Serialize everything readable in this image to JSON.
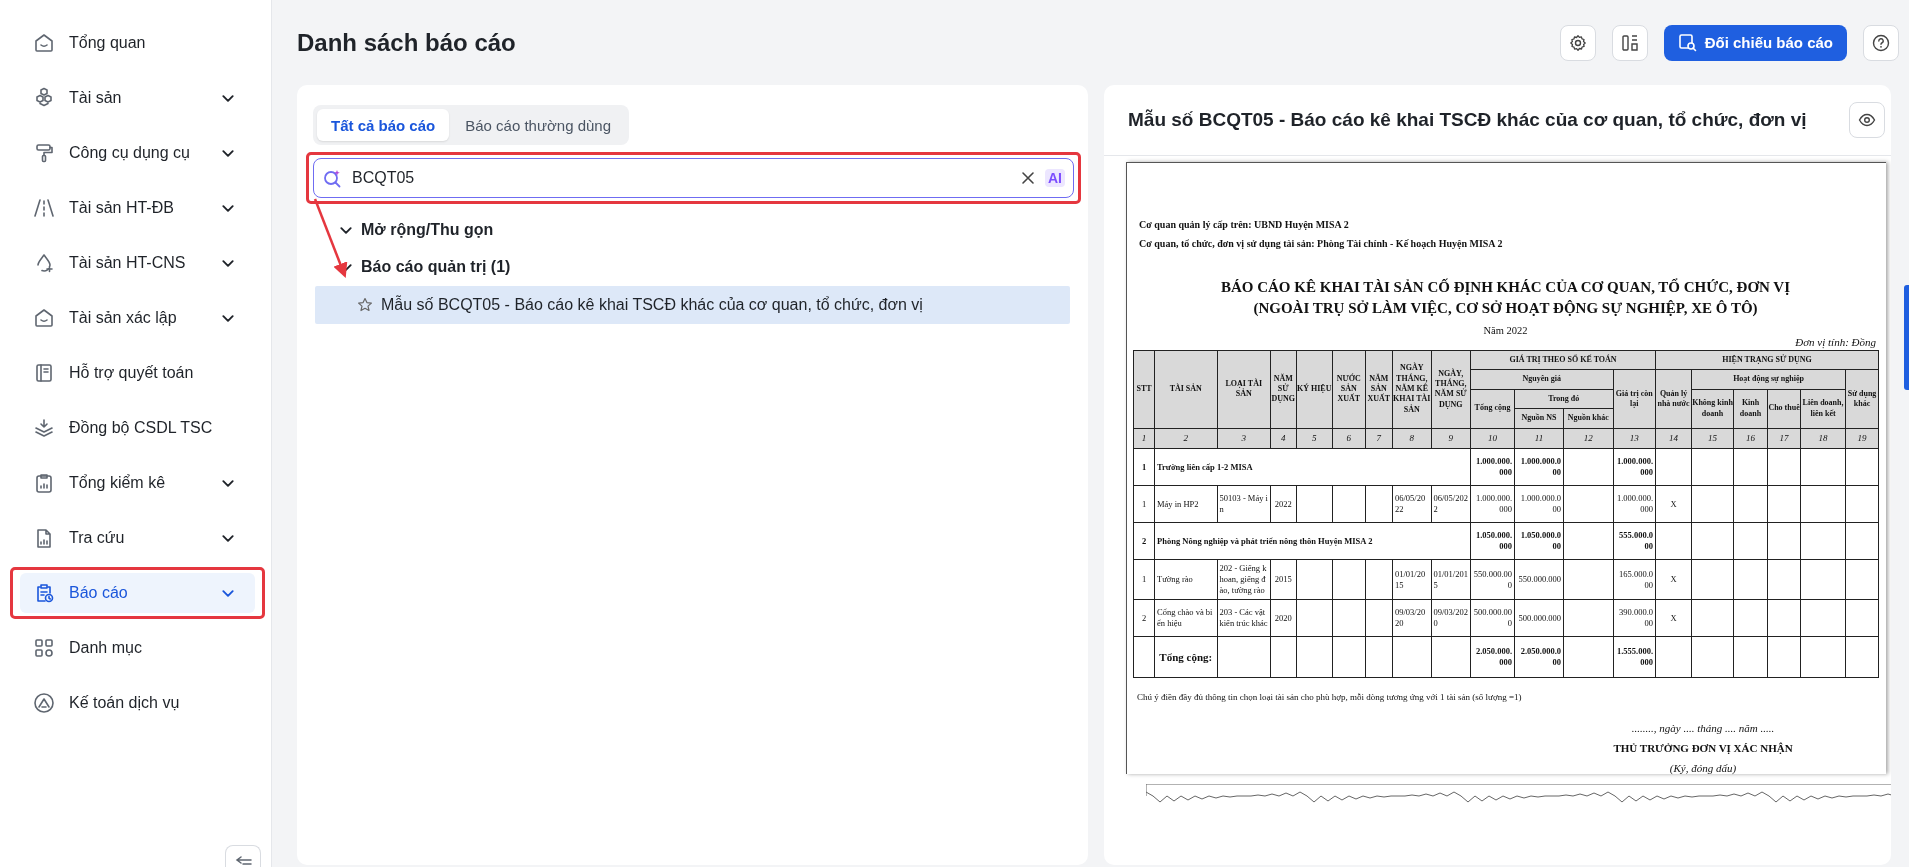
{
  "sidebar": {
    "items": [
      {
        "label": "Tổng quan",
        "expandable": false,
        "selected": false,
        "annotated": false
      },
      {
        "label": "Tài sản",
        "expandable": true,
        "selected": false,
        "annotated": false
      },
      {
        "label": "Công cụ dụng cụ",
        "expandable": true,
        "selected": false,
        "annotated": false
      },
      {
        "label": "Tài sản HT-ĐB",
        "expandable": true,
        "selected": false,
        "annotated": false
      },
      {
        "label": "Tài sản HT-CNS",
        "expandable": true,
        "selected": false,
        "annotated": false
      },
      {
        "label": "Tài sản xác lập",
        "expandable": true,
        "selected": false,
        "annotated": false
      },
      {
        "label": "Hỗ trợ quyết toán",
        "expandable": false,
        "selected": false,
        "annotated": false
      },
      {
        "label": "Đồng bộ CSDL TSC",
        "expandable": false,
        "selected": false,
        "annotated": false
      },
      {
        "label": "Tổng kiểm kê",
        "expandable": true,
        "selected": false,
        "annotated": false
      },
      {
        "label": "Tra cứu",
        "expandable": true,
        "selected": false,
        "annotated": false
      },
      {
        "label": "Báo cáo",
        "expandable": true,
        "selected": true,
        "annotated": true
      },
      {
        "label": "Danh mục",
        "expandable": false,
        "selected": false,
        "annotated": false
      },
      {
        "label": "Kế toán dịch vụ",
        "expandable": false,
        "selected": false,
        "annotated": false
      }
    ]
  },
  "page": {
    "title": "Danh sách báo cáo",
    "primary_button": "Đối chiếu báo cáo"
  },
  "left_panel": {
    "tabs": [
      {
        "label": "Tất cả báo cáo",
        "selected": true
      },
      {
        "label": "Báo cáo thường dùng",
        "selected": false
      }
    ],
    "search": {
      "value": "BCQT05",
      "badge": "AI",
      "annotated": true
    },
    "tree": {
      "toggle": {
        "label": "Mở rộng/Thu gọn",
        "expanded": true
      },
      "groups": [
        {
          "label": "Báo cáo quản trị (1)",
          "expanded": true,
          "children": [
            {
              "label": "Mẫu số BCQT05 - Báo cáo kê khai TSCĐ khác của cơ quan, tổ chức, đơn vị",
              "selected": true,
              "starred": false
            }
          ]
        }
      ]
    }
  },
  "preview": {
    "title": "Mẫu số BCQT05 - Báo cáo kê khai TSCĐ khác của cơ quan, tổ chức, đơn vị",
    "document": {
      "header_lines": [
        "Cơ quan quản lý cấp trên: UBND Huyện MISA 2",
        "Cơ quan, tổ chức, đơn vị sử dụng tài sản: Phòng Tài chính - Kế hoạch Huyện MISA 2"
      ],
      "title_lines": [
        "BÁO CÁO KÊ KHAI TÀI SẢN CỐ ĐỊNH KHÁC CỦA CƠ QUAN, TỔ CHỨC, ĐƠN VỊ",
        "(NGOÀI TRỤ SỞ LÀM VIỆC, CƠ SỞ HOẠT ĐỘNG SỰ NGHIỆP, XE Ô TÔ)"
      ],
      "year": "Năm 2022",
      "unit": "Đơn vị tính: Đồng",
      "columns": [
        {
          "label": "STT",
          "number": "1"
        },
        {
          "label": "TÀI SẢN",
          "number": "2"
        },
        {
          "label": "LOẠI TÀI SẢN",
          "number": "3"
        },
        {
          "label": "NĂM SỬ DỤNG",
          "number": "4"
        },
        {
          "label": "KÝ HIỆU",
          "number": "5"
        },
        {
          "label": "NƯỚC SẢN XUẤT",
          "number": "6"
        },
        {
          "label": "NĂM SẢN XUẤT",
          "number": "7"
        },
        {
          "label": "NGÀY THÁNG, NĂM KÊ KHAI TÀI SẢN",
          "number": "8"
        },
        {
          "label": "NGÀY, THÁNG, NĂM SỬ DỤNG",
          "number": "9"
        },
        {
          "label": "GIÁ TRỊ THEO SỔ KẾ TOÁN",
          "children": [
            {
              "label": "Nguyên giá",
              "children": [
                {
                  "label": "Tổng cộng",
                  "number": "10"
                },
                {
                  "label": "Trong đó",
                  "children": [
                    {
                      "label": "Nguồn NS",
                      "number": "11"
                    },
                    {
                      "label": "Nguồn khác",
                      "number": "12"
                    }
                  ]
                }
              ]
            },
            {
              "label": "Giá trị còn lại",
              "number": "13"
            }
          ]
        },
        {
          "label": "HIỆN TRẠNG SỬ DỤNG",
          "children": [
            {
              "label": "Quản lý nhà nước",
              "number": "14"
            },
            {
              "label": "Hoạt động sự nghiệp",
              "children": [
                {
                  "label": "Không kinh doanh",
                  "number": "15"
                },
                {
                  "label": "Kinh doanh",
                  "number": "16"
                },
                {
                  "label": "Cho thuê",
                  "number": "17"
                },
                {
                  "label": "Liên doanh, liên kết",
                  "number": "18"
                }
              ]
            },
            {
              "label": "Sử dụng khác",
              "number": "19"
            }
          ]
        }
      ],
      "rows": [
        {
          "kind": "group",
          "cells": {
            "1": "1",
            "2": "Trường liên cấp 1-2 MISA",
            "10": "1.000.000.000",
            "11": "1.000.000.000",
            "13": "1.000.000.000"
          }
        },
        {
          "kind": "item",
          "cells": {
            "1": "1",
            "2": "Máy in HP2",
            "3": "50103 - Máy in",
            "4": "2022",
            "8": "06/05/2022",
            "9": "06/05/2022",
            "10": "1.000.000.000",
            "11": "1.000.000.000",
            "13": "1.000.000.000",
            "14": "X"
          }
        },
        {
          "kind": "group",
          "cells": {
            "1": "2",
            "2": "Phòng Nông nghiệp và phát triển nông thôn Huyện MISA 2",
            "10": "1.050.000.000",
            "11": "1.050.000.000",
            "13": "555.000.000"
          }
        },
        {
          "kind": "item",
          "cells": {
            "1": "1",
            "2": "Tường rào",
            "3": "202 - Giếng khoan, giếng đào, tường rào",
            "4": "2015",
            "8": "01/01/2015",
            "9": "01/01/2015",
            "10": "550.000.000",
            "11": "550.000.000",
            "13": "165.000.000",
            "14": "X"
          }
        },
        {
          "kind": "item",
          "cells": {
            "1": "2",
            "2": "Cổng chào và biển hiệu",
            "3": "203 - Các vật kiến trúc khác",
            "4": "2020",
            "8": "09/03/2020",
            "9": "09/03/2020",
            "10": "500.000.000",
            "11": "500.000.000",
            "13": "390.000.000",
            "14": "X"
          }
        },
        {
          "kind": "total",
          "cells": {
            "2": "Tổng cộng:",
            "10": "2.050.000.000",
            "11": "2.050.000.000",
            "13": "1.555.000.000"
          }
        }
      ],
      "note": "Chú ý điền đầy đủ thông tin chọn loại tài sản cho phù hợp, mỗi dòng tương ứng với 1 tài sản (số lượng =1)",
      "signature": {
        "date_line": "........, ngày .... tháng .... năm .....",
        "title": "THỦ TRƯỞNG ĐƠN VỊ XÁC NHẬN",
        "hint": "(Ký, đóng dấu)"
      }
    }
  }
}
